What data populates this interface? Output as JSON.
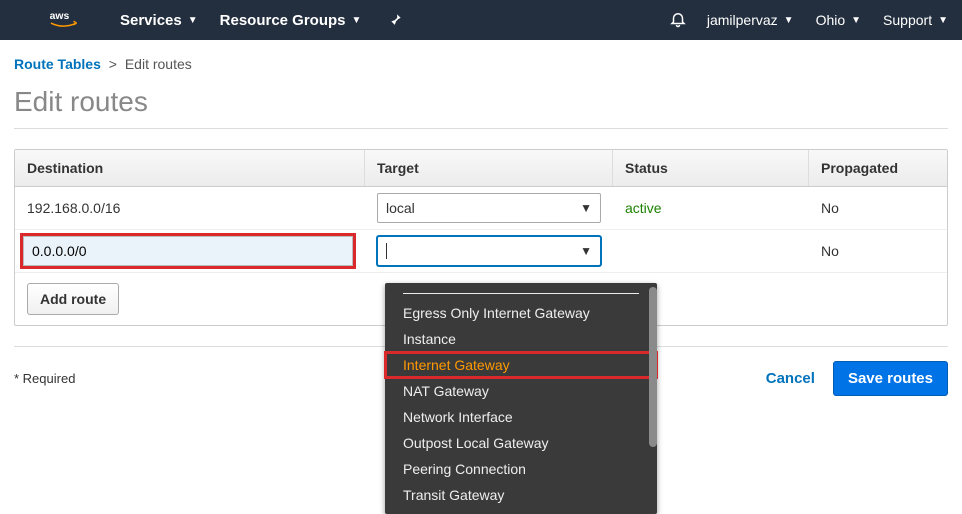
{
  "header": {
    "services": "Services",
    "resource_groups": "Resource Groups",
    "user": "jamilpervaz",
    "region": "Ohio",
    "support": "Support"
  },
  "breadcrumb": {
    "route_tables": "Route Tables",
    "current": "Edit routes"
  },
  "page_title": "Edit routes",
  "table": {
    "headers": {
      "destination": "Destination",
      "target": "Target",
      "status": "Status",
      "propagated": "Propagated"
    },
    "rows": [
      {
        "destination": "192.168.0.0/16",
        "target": "local",
        "status": "active",
        "propagated": "No"
      },
      {
        "destination": "0.0.0.0/0",
        "target": "",
        "status": "",
        "propagated": "No"
      }
    ]
  },
  "add_route": "Add route",
  "dropdown": {
    "items": [
      "Egress Only Internet Gateway",
      "Instance",
      "Internet Gateway",
      "NAT Gateway",
      "Network Interface",
      "Outpost Local Gateway",
      "Peering Connection",
      "Transit Gateway"
    ]
  },
  "footer": {
    "required": "* Required",
    "cancel": "Cancel",
    "save": "Save routes"
  }
}
